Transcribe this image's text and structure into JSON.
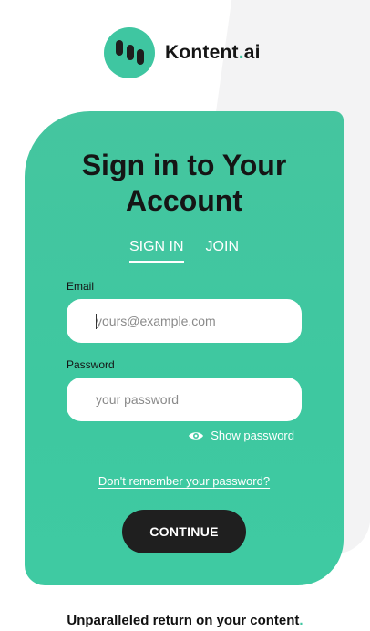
{
  "brand": {
    "name_main": "Kontent",
    "name_dot": ".",
    "name_suffix": "ai",
    "accent_color": "#3fc6a1"
  },
  "card": {
    "title": "Sign in to Your Account",
    "color": "#40c8a1"
  },
  "tabs": [
    {
      "label": "SIGN IN",
      "active": true
    },
    {
      "label": "JOIN",
      "active": false
    }
  ],
  "email": {
    "label": "Email",
    "placeholder": "yours@example.com",
    "value": ""
  },
  "password": {
    "label": "Password",
    "placeholder": "your password",
    "value": ""
  },
  "show_password": {
    "icon": "eye-icon",
    "label": "Show password"
  },
  "forgot_link": "Don't remember your password?",
  "continue_button": "CONTINUE",
  "tagline": {
    "text": "Unparalleled return on your content",
    "dot": "."
  }
}
